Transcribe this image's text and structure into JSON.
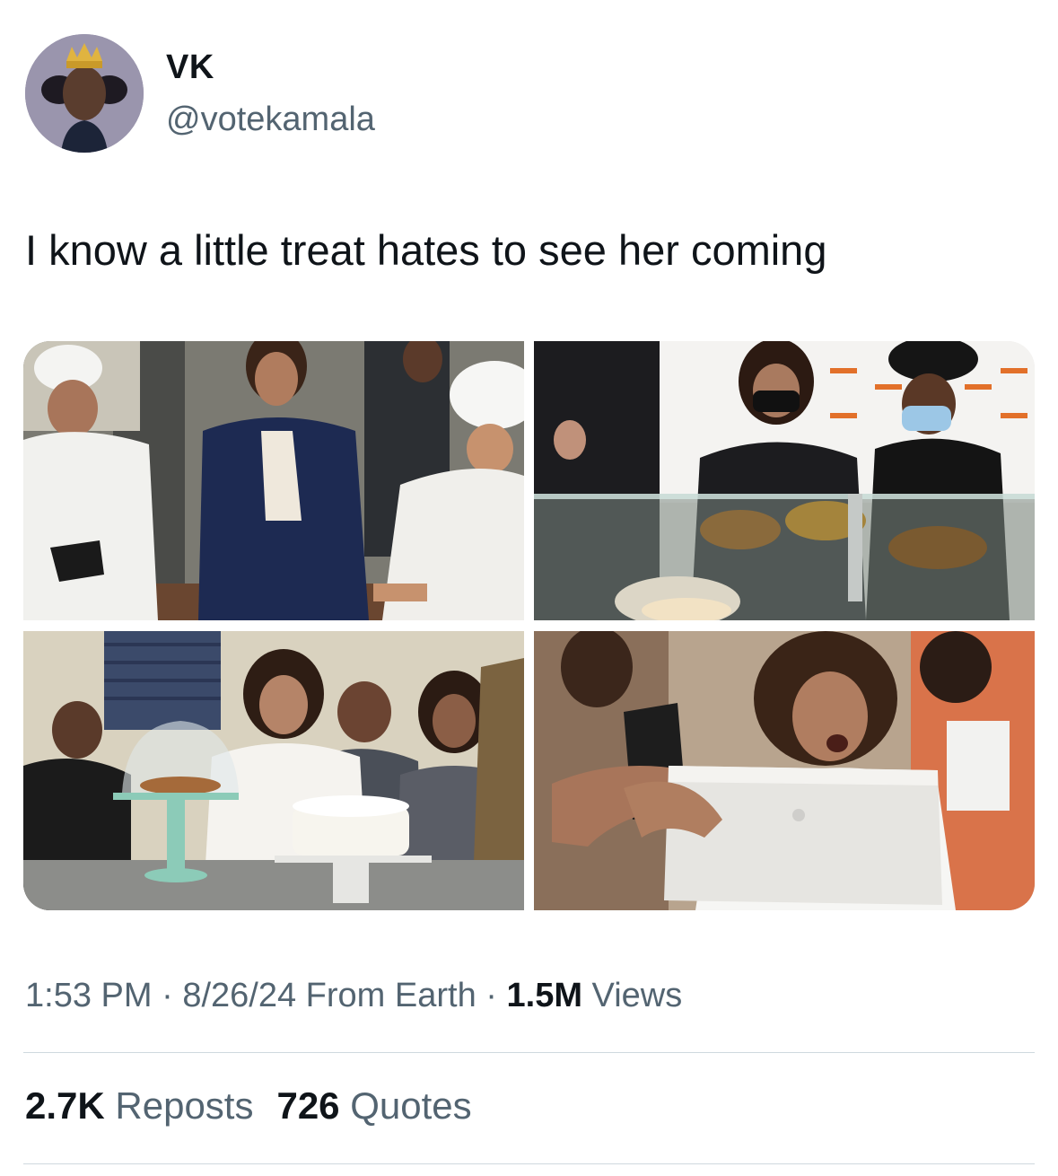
{
  "tweet": {
    "display_name": "VK",
    "handle": "@votekamala",
    "text": "I know a little treat hates to see her coming",
    "time": "1:53 PM",
    "separator": "·",
    "date": "8/26/24",
    "source": "From Earth",
    "views_count": "1.5M",
    "views_label": "Views"
  },
  "engagement": {
    "reposts_count": "2.7K",
    "reposts_label": "Reposts",
    "quotes_count": "726",
    "quotes_label": "Quotes"
  },
  "media": [
    {
      "icon": "photo-bakery-chefs"
    },
    {
      "icon": "photo-display-case"
    },
    {
      "icon": "photo-cake-counter"
    },
    {
      "icon": "photo-box-surprise"
    }
  ]
}
